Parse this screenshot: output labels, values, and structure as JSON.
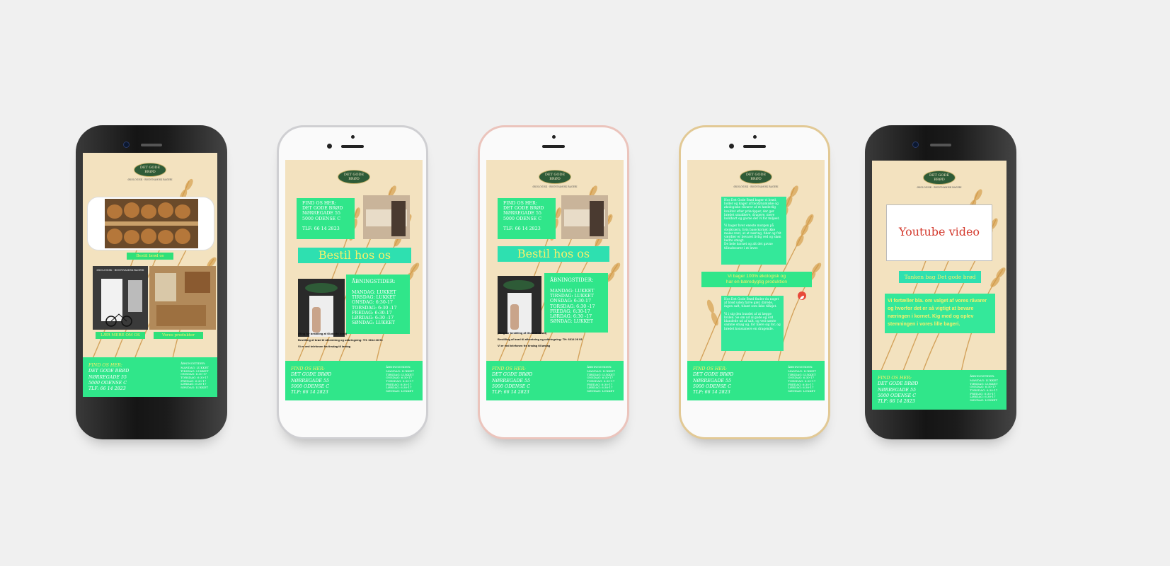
{
  "brand": {
    "logo_text": "DET GODE BRØD",
    "tagline": "ØKOLOGISK · BIODYNAMISK BAGERI"
  },
  "footer": {
    "find_label": "FIND OS HER:",
    "name": "DET GODE BRØD",
    "street": "NØRREGADE 55",
    "city": "5000 ODENSE C",
    "phone": "TLF: 66 14 2823",
    "hours_title": "ÅBNINGSTIDER:",
    "hours": "MANDAG: LUKKET\nTIRSDAG: LUKKET\nONSDAG: 6:30-17\nTORSDAG: 6:30-17\nFREDAG: 6:30-17\nLØRDAG: 6:30-17\nSØNDAG: LUKKET"
  },
  "screen1": {
    "order_button": "Bestil brød os",
    "learn_button": "LÆR MERE OM OS",
    "products_button": "Vores produkter",
    "shop_sign": "ØKOLOGISK · BIODYNAMISK BAGERI"
  },
  "screen2": {
    "find_box": "FIND OS HER:\nDET GODE BRØD\nNØRREGADE 55\n5000 ODENSE C\n\nTLF: 66 14 2823",
    "order_banner": "Bestil hos os",
    "hours_title": "ÅBNINGSTIDER:",
    "hours": "MANDAG: LUKKET\nTIRSDAG: LUKKET\nONSDAG: 6:30-17\nTORSDAG: 6:30 -17\nFREDAG: 6:30-17\nLØRDAG: 6:30 -17\nSØNDAG: LUKKET",
    "note1": "(Ring for bestilling af Glutenfri brød)",
    "note2": "Bestilling af brød til afhentning og udbringning: TH: 6614 28 93",
    "note3": "Vi er ved telefonen fra tirsdag til lørdag"
  },
  "screen4": {
    "text1": "Hos Det Gode Brød bager vi brød, boller og kager af biodynamiske og økologiske råvarer af et hæderlig kvalitet efter principper, der gør brødet smukkere, dragere, mere holdbart og gavne det vi for miljøet.\n\nVi bager hver eneste morgen på stenkværn, hvis base kornet ikke males rent, at at næring, fiber og frit værdier er bevaret livlig ved og skøn bedre smagt.\nDe hele kornet og alt det gavne tilbudsvarer i et lever.",
    "banner": "Vi bager 100% økologisk og\nhar en bæredygtig produktion",
    "text2": "Hos Det Gode Brød finder du noget af brød uden farve gær, dyrede, ingen saft, tilsæt som ikke tilføjet.\n\nVi i sig den bundet af at lægge hvilen. Se om ud al gode og ord blandede ud af salt, og ved næste samme smag og, for bære sig for, og brødet konsumere en dragende.",
    "icon": "organic-leaf-icon"
  },
  "screen5": {
    "video_label": "Youtube video",
    "thoughts_button": "Tanken bag Det gode brød",
    "info": "Vi fortæller bla. om valget af vores råvarer og hvorfor det er så vigtigt at bevare næringen i kornet. Kig med og oplev stemningen i vores lille bageri."
  },
  "colors": {
    "green": "#30e68a",
    "teal": "#2ee0b0",
    "cream": "#f3e2bf",
    "yellow": "#f7f06b",
    "video_red": "#d43b2f"
  }
}
